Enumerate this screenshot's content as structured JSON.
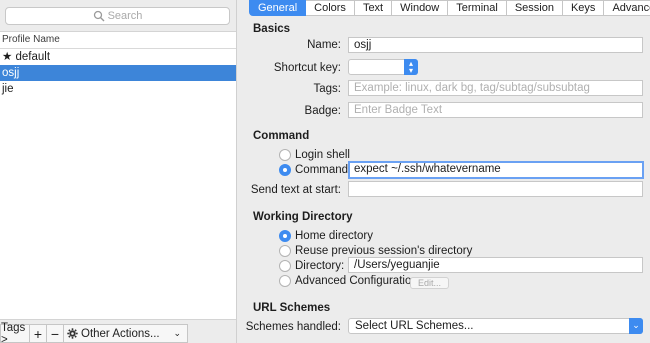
{
  "search": {
    "placeholder": "Search"
  },
  "profiles": {
    "header": "Profile Name",
    "items": [
      {
        "label": "★ default"
      },
      {
        "label": "osjj"
      },
      {
        "label": "jie"
      }
    ]
  },
  "bottom_bar": {
    "tags_label": "Tags >",
    "plus_label": "+",
    "minus_label": "−",
    "other_actions_label": "Other Actions..."
  },
  "tabs": [
    {
      "label": "General"
    },
    {
      "label": "Colors"
    },
    {
      "label": "Text"
    },
    {
      "label": "Window"
    },
    {
      "label": "Terminal"
    },
    {
      "label": "Session"
    },
    {
      "label": "Keys"
    },
    {
      "label": "Advanced"
    }
  ],
  "basics": {
    "title": "Basics",
    "name_label": "Name:",
    "name_value": "osjj",
    "shortcut_label": "Shortcut key:",
    "tags_label": "Tags:",
    "tags_placeholder": "Example: linux, dark bg, tag/subtag/subsubtag",
    "badge_label": "Badge:",
    "badge_placeholder": "Enter Badge Text"
  },
  "command": {
    "title": "Command",
    "login_shell_label": "Login shell",
    "command_label": "Command:",
    "command_value": "expect ~/.ssh/whatevername",
    "send_text_label": "Send text at start:"
  },
  "working_directory": {
    "title": "Working Directory",
    "home_label": "Home directory",
    "reuse_label": "Reuse previous session's directory",
    "directory_label": "Directory:",
    "directory_value": "/Users/yeguanjie",
    "advanced_label": "Advanced Configuration",
    "edit_label": "Edit..."
  },
  "url_schemes": {
    "title": "URL Schemes",
    "handled_label": "Schemes handled:",
    "select_value": "Select URL Schemes..."
  },
  "colors": {
    "accent": "#3d8bf0",
    "selection": "#3d85d9"
  }
}
